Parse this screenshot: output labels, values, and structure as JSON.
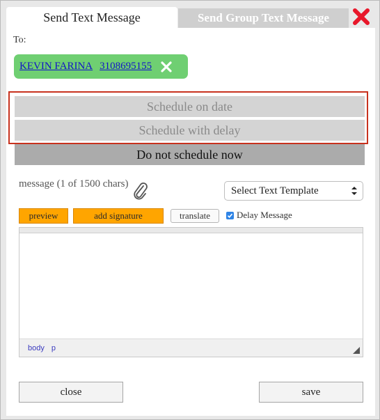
{
  "tabs": [
    {
      "label": "Send Text Message",
      "active": true
    },
    {
      "label": "Send Group Text Message",
      "active": false
    }
  ],
  "recipient": {
    "to_label": "To:",
    "name": "KEVIN FARINA",
    "phone": "3108695155"
  },
  "schedule": {
    "on_date": "Schedule on date",
    "with_delay": "Schedule with delay",
    "now": "Do not schedule now"
  },
  "message": {
    "label": "message (1 of 1500 chars)",
    "template_selected": "Select Text Template",
    "preview": "preview",
    "add_signature": "add signature",
    "translate": "translate",
    "delay_label": "Delay Message",
    "delay_checked": true,
    "path": [
      "body",
      "p"
    ]
  },
  "footer": {
    "close": "close",
    "save": "save"
  },
  "colors": {
    "accent_orange": "#ffa500",
    "chip_green": "#6fcf72",
    "highlight_red": "#c8321e",
    "close_red": "#e8172a"
  },
  "icons": {
    "close": "close-icon",
    "remove_recipient": "remove-recipient-icon",
    "attach": "paperclip-icon",
    "select": "select-arrows-icon",
    "resize": "resize-grip-icon"
  }
}
